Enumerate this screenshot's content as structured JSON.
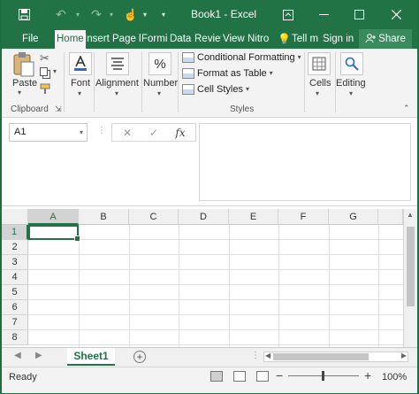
{
  "window": {
    "title": "Book1 - Excel",
    "save_icon": "floppy-disk-icon",
    "undo_icon": "undo-icon",
    "redo_icon": "redo-icon",
    "touch_icon": "touch-mode-icon",
    "customize_icon": "customize-qat-icon",
    "ribbon_display_icon": "ribbon-display-options-icon",
    "minimize_icon": "minimize-icon",
    "maximize_icon": "maximize-icon",
    "close_icon": "close-icon"
  },
  "tabs": [
    {
      "label": "File"
    },
    {
      "label": "Home",
      "active": true
    },
    {
      "label": "Insert"
    },
    {
      "label": "Page l"
    },
    {
      "label": "Formi"
    },
    {
      "label": "Data"
    },
    {
      "label": "Reviev"
    },
    {
      "label": "View"
    },
    {
      "label": "Nitro"
    }
  ],
  "tell_me": "Tell m",
  "sign_in": "Sign in",
  "share": "Share",
  "ribbon": {
    "clipboard": {
      "paste": "Paste",
      "group_label": "Clipboard"
    },
    "font_label": "Font",
    "alignment_label": "Alignment",
    "number_label": "Number",
    "styles": {
      "conditional_formatting": "Conditional Formatting",
      "format_as_table": "Format as Table",
      "cell_styles": "Cell Styles",
      "group_label": "Styles"
    },
    "cells_label": "Cells",
    "editing_label": "Editing"
  },
  "formula_bar": {
    "name_box": "A1",
    "cancel_glyph": "✕",
    "enter_glyph": "✓",
    "fx_glyph": "fx",
    "value": ""
  },
  "columns": [
    "A",
    "B",
    "C",
    "D",
    "E",
    "F",
    "G"
  ],
  "rows": [
    "1",
    "2",
    "3",
    "4",
    "5",
    "6",
    "7",
    "8"
  ],
  "sheet_tabs": [
    {
      "label": "Sheet1",
      "active": true
    }
  ],
  "add_sheet": "+",
  "status": {
    "text": "Ready",
    "zoom_minus": "−",
    "zoom_plus": "+",
    "zoom": "100%"
  }
}
